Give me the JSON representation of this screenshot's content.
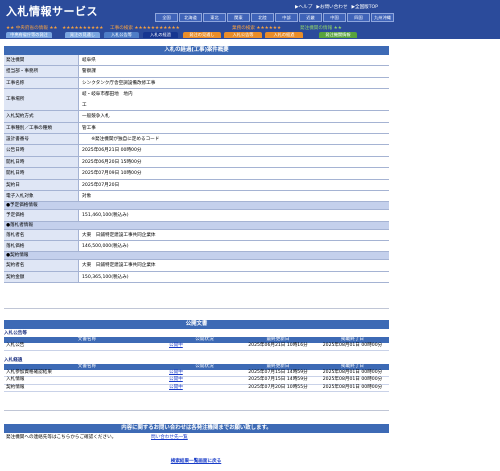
{
  "header": {
    "title": "入札情報サービス",
    "links": [
      "▶ヘルプ",
      "▶お問い合わせ",
      "▶全国版TOP"
    ],
    "regions": [
      "全国",
      "北海道",
      "東北",
      "関東",
      "北陸",
      "中部",
      "近畿",
      "中国",
      "四国",
      "九州沖縄"
    ]
  },
  "categories": {
    "left": "★★ 中央府省の情報 ★★　★★★★★★★★★★",
    "mid": "工事の検索 ★★★★★★★★★★★",
    "right": "業務の検索 ★★★★★★",
    "far": "発注機関の情報 ★★"
  },
  "tabs": [
    {
      "label": "中央府省庁等の発注",
      "color": "#7aa6e0"
    },
    {
      "label": "発注の見通し",
      "color": "#7aa6e0"
    },
    {
      "label": "入札公告等",
      "color": "#4f7ec7"
    },
    {
      "label": "入札の経過",
      "color": "#163690"
    },
    {
      "label": "発注の見通し",
      "color": "#e98d2a"
    },
    {
      "label": "入札公告等",
      "color": "#e98d2a"
    },
    {
      "label": "入札の経過",
      "color": "#e98d2a"
    },
    {
      "label": "発注機関情報",
      "color": "#58a33d"
    }
  ],
  "main": {
    "title": "入札の経過(工事)案件概要",
    "rows": [
      {
        "label": "発注機関",
        "value": "岐阜県"
      },
      {
        "label": "担当部・事務所",
        "value": "警察課"
      },
      {
        "label": "工事名称",
        "value": "シンクタンク庁舎空調設備改修工事"
      },
      {
        "label": "工事場所",
        "value": "岐・岐阜市都田地　地内"
      },
      {
        "label": "",
        "value": "工"
      },
      {
        "label": "入札契約方式",
        "value": "一般競争入札"
      },
      {
        "label": "工事種別／工事の種類",
        "value": "管工事"
      },
      {
        "label": "設計書番号",
        "value": "　　※発注機関が独自に定めるコード"
      },
      {
        "label": "公告日時",
        "value": "2025年06月21日 00時00分"
      },
      {
        "label": "開札日時",
        "value": "2025年06月20日 15時00分"
      },
      {
        "label": "開札日時",
        "value": "2025年07月09日 10時00分"
      },
      {
        "label": "契約日",
        "value": "2025年07月20日"
      },
      {
        "label": "電子入札対象",
        "value": "対象"
      }
    ],
    "sect1": "●予定価格情報",
    "rows2": [
      {
        "label": "予定価格",
        "value": "151,460,100(税込み)"
      }
    ],
    "sect2": "●落札者情報",
    "rows3": [
      {
        "label": "落札者名",
        "value": "大東　日鋪特定建設工事共同企業体"
      },
      {
        "label": "落札価格",
        "value": "146,500,000(税込み)"
      }
    ],
    "sect3": "●契約情報",
    "rows4": [
      {
        "label": "契約者名",
        "value": "大東　日鋪特定建設工事共同企業体"
      },
      {
        "label": "契約金額",
        "value": "150,365,100(税込み)"
      }
    ]
  },
  "docs": {
    "title": "公開文書",
    "sec1": "入札公告等",
    "head": [
      "文書名称",
      "公開状況",
      "最終更新日",
      "掲載終了日"
    ],
    "rows1": [
      [
        "入札公告",
        "公開中",
        "2025年06月21日 10時16分",
        "2025年08月01日 00時00分"
      ]
    ],
    "sec2": "入札経過",
    "rows2": [
      [
        "入札参加資格確認結果",
        "公開中",
        "2025年07月15日 14時59分",
        "2025年08月01日 00時00分"
      ],
      [
        "入札情報",
        "公開中",
        "2025年07月15日 14時59分",
        "2025年08月01日 00時00分"
      ],
      [
        "契約情報",
        "公開中",
        "2025年07月20日 10時55分",
        "2025年08月01日 00時00分"
      ]
    ]
  },
  "contact": {
    "title": "内容に関するお問い合わせは各発注機関までお願い致します。",
    "label": "発注機関への連絡先等はこちらからご確認ください。",
    "link": "問い合わせ先一覧"
  },
  "footer_link": "検索結果一覧画面に戻る"
}
